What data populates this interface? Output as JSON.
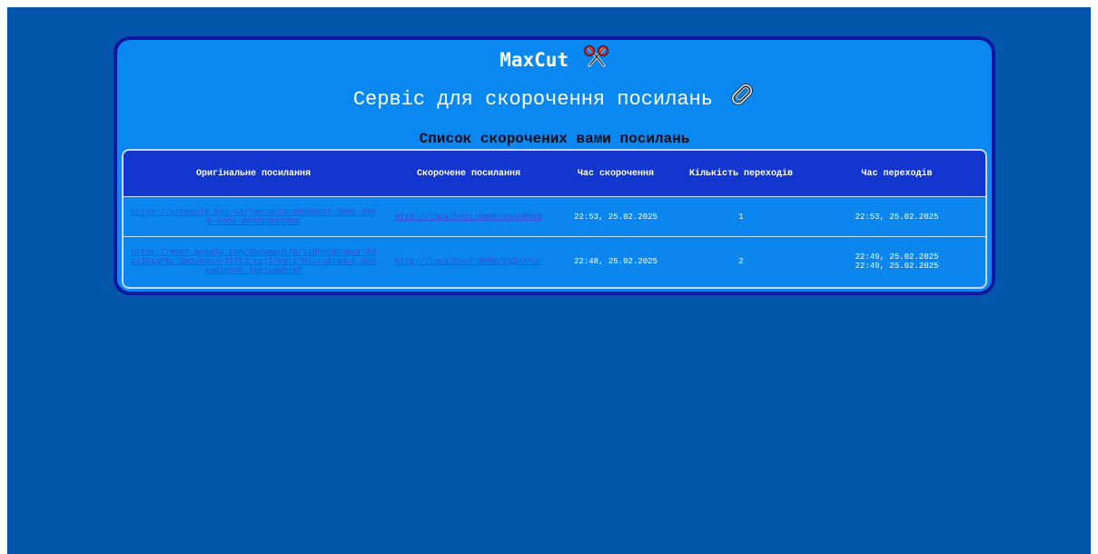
{
  "header": {
    "brand": "MaxCut",
    "brand_icon": "scissors-icon",
    "subtitle": "Сервіс для скорочення посилань",
    "subtitle_icon": "paperclip-icon",
    "list_title": "Список скорочених вами посилань"
  },
  "table": {
    "columns": [
      "Оригінальне посилання",
      "Скорочене посилання",
      "Час скорочення",
      "Кількість переходів",
      "Час переходів"
    ],
    "rows": [
      {
        "original": "https://schedule.kpi.ua/?groupId=00000a5f-0000-0000-0000-000000000000",
        "short": "http://localhost:8000/H6AAR8a9",
        "created": "22:53, 25.02.2025",
        "clicks": "1",
        "click_times": [
          "22:53, 25.02.2025"
        ]
      },
      {
        "original": "https://docs.google.com/document/d/118hccKcuwxt-59ai2GigPkclGmIokdoAr2I7t3_vzjI/edit?hl=ru&tab=t.0#heading=h.jgsjzaqhimf",
        "short": "http://localhost:8000/dg2eAYur",
        "created": "22:48, 25.02.2025",
        "clicks": "2",
        "click_times": [
          "22:49, 25.02.2025",
          "22:49, 25.02.2025"
        ]
      }
    ]
  },
  "colors": {
    "page_bg": "#0456ad",
    "card_bg": "#0888f0",
    "card_border": "#0d17a0",
    "table_header_bg": "#1336cf",
    "link": "#3b49d6"
  }
}
